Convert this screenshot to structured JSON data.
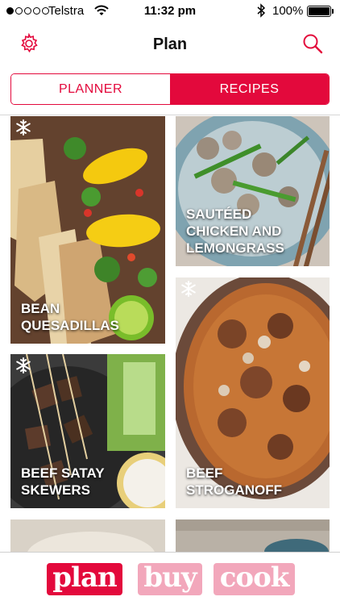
{
  "status_bar": {
    "carrier": "Telstra",
    "time": "11:32 pm",
    "battery_percent": "100%",
    "signal_bars_filled": 1,
    "signal_bars_total": 5,
    "battery_level": 1.0
  },
  "nav": {
    "title": "Plan",
    "settings_icon": "gear-icon",
    "search_icon": "search-icon"
  },
  "segment": {
    "planner_label": "PLANNER",
    "recipes_label": "RECIPES",
    "selected": "RECIPES"
  },
  "recipes": [
    {
      "title": "BEAN QUESADILLAS",
      "line1": "BEAN",
      "line2": "QUESADILLAS",
      "freezable": true
    },
    {
      "title": "SAUTÉED CHICKEN AND LEMONGRASS",
      "line1": "SAUTÉED",
      "line2": "CHICKEN AND",
      "line3": "LEMONGRASS",
      "freezable": false
    },
    {
      "title": "BEEF STROGANOFF",
      "line1": "BEEF",
      "line2": "STROGANOFF",
      "freezable": true
    },
    {
      "title": "BEEF SATAY SKEWERS",
      "line1": "BEEF SATAY",
      "line2": "SKEWERS",
      "freezable": true
    }
  ],
  "tabbar": {
    "plan_label": "plan",
    "buy_label": "buy",
    "cook_label": "cook",
    "active": "plan"
  },
  "colors": {
    "accent": "#e3093c",
    "accent_light": "#f2a7bb"
  }
}
